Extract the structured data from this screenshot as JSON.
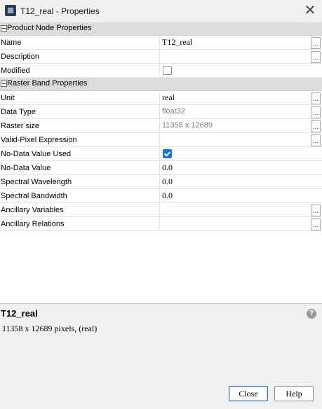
{
  "window": {
    "title": "T12_real - Properties"
  },
  "sections": {
    "product": {
      "label": "Product Node Properties",
      "rows": [
        {
          "name": "Name",
          "value": "T12_real"
        },
        {
          "name": "Description",
          "value": ""
        },
        {
          "name": "Modified",
          "checked": false
        }
      ]
    },
    "raster": {
      "label": "Raster Band Properties",
      "rows": [
        {
          "name": "Unit",
          "value": "real"
        },
        {
          "name": "Data Type",
          "value": "float32"
        },
        {
          "name": "Raster size",
          "value": "11358 x 12689"
        },
        {
          "name": "Valid-Pixel Expression",
          "value": ""
        },
        {
          "name": "No-Data Value Used",
          "checked": true
        },
        {
          "name": "No-Data Value",
          "value": "0.0"
        },
        {
          "name": "Spectral Wavelength",
          "value": "0.0"
        },
        {
          "name": "Spectral Bandwidth",
          "value": "0.0"
        },
        {
          "name": "Ancillary Variables",
          "value": ""
        },
        {
          "name": "Ancillary Relations",
          "value": ""
        }
      ]
    }
  },
  "info": {
    "title": "T12_real",
    "description": "11358 x 12689 pixels, (real)"
  },
  "buttons": {
    "close": "Close",
    "help": "Help"
  },
  "dots_label": "...",
  "help_icon": "?",
  "close_glyph": "✕"
}
